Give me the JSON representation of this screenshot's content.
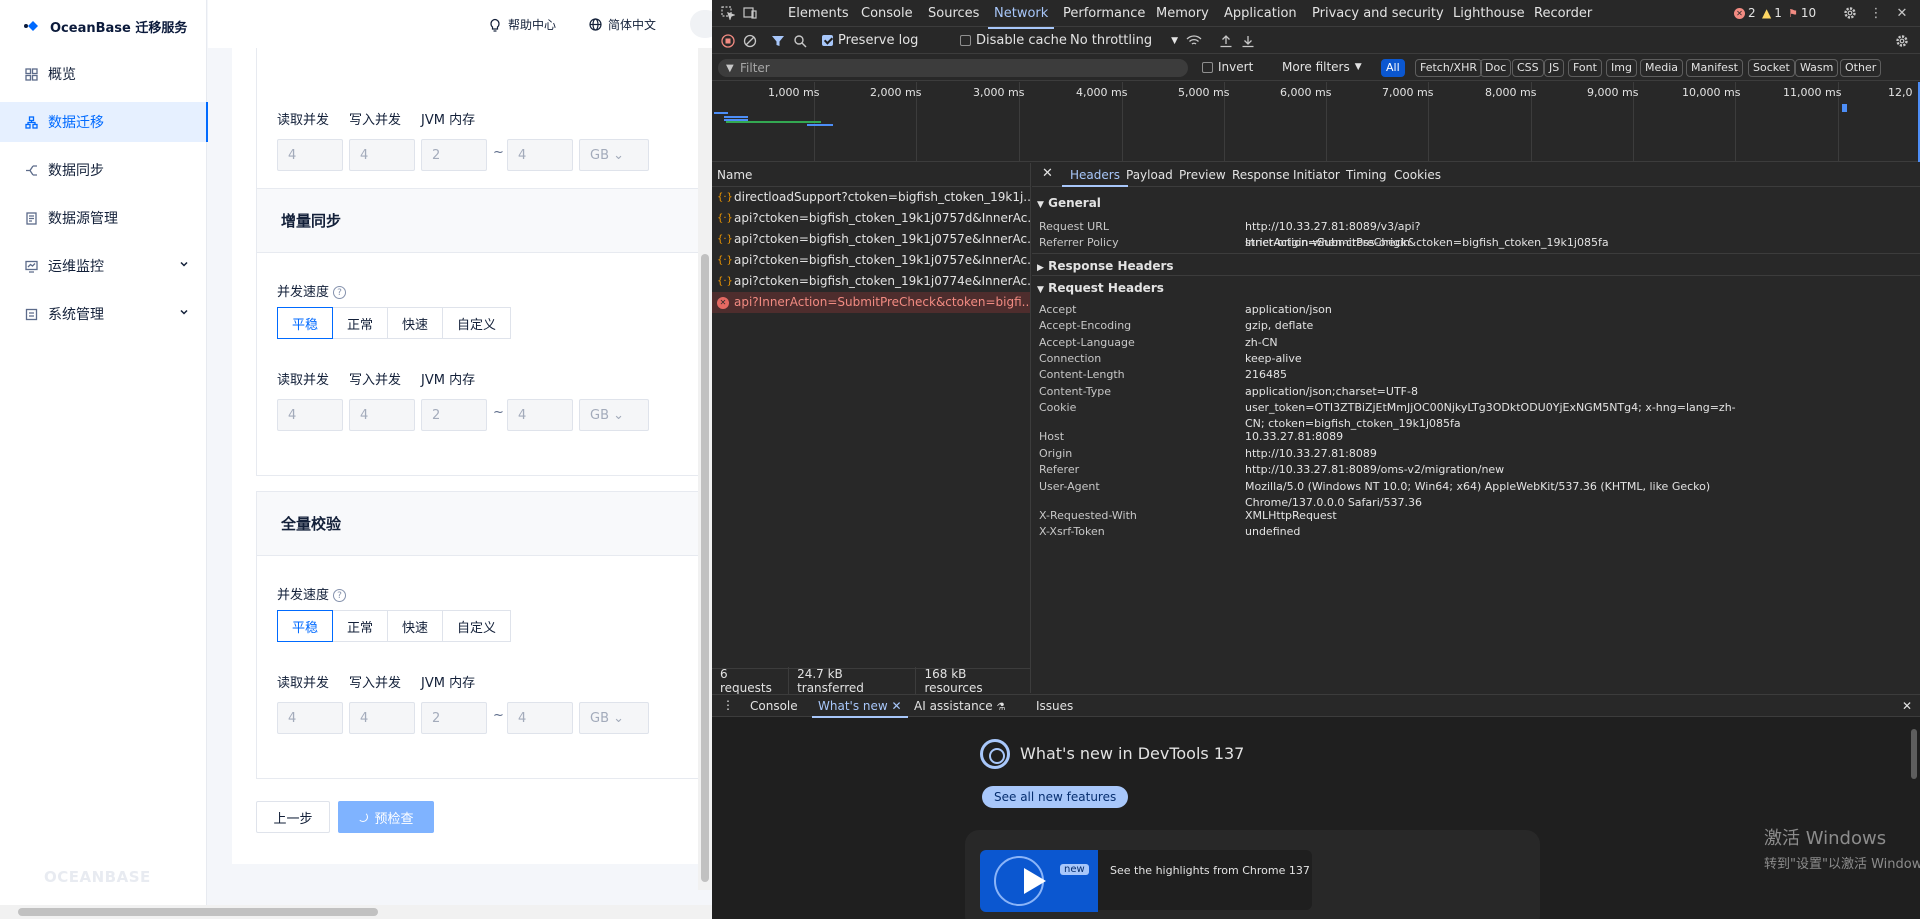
{
  "app": {
    "brand": "OceanBase 迁移服务",
    "footer_logo": "OCEANBASE",
    "sidebar": {
      "items": [
        {
          "label": "概览",
          "icon": "grid-icon"
        },
        {
          "label": "数据迁移",
          "icon": "migration-icon"
        },
        {
          "label": "数据同步",
          "icon": "sync-icon"
        },
        {
          "label": "数据源管理",
          "icon": "datasource-icon"
        },
        {
          "label": "运维监控",
          "icon": "monitor-icon"
        },
        {
          "label": "系统管理",
          "icon": "system-icon"
        }
      ]
    },
    "topbar": {
      "help": "帮助中心",
      "language": "简体中文"
    },
    "sections": {
      "fields": {
        "read": "读取并发",
        "write": "写入并发",
        "jvm": "JVM 内存",
        "tilde": "~",
        "unit": "GB"
      },
      "s0": {
        "read": "4",
        "write": "4",
        "jvm_min": "2",
        "jvm_max": "4"
      },
      "incremental": {
        "title": "增量同步",
        "speed_label": "并发速度",
        "read": "4",
        "write": "4",
        "jvm_min": "2",
        "jvm_max": "4"
      },
      "full": {
        "title": "全量校验",
        "speed_label": "并发速度",
        "read": "4",
        "write": "4",
        "jvm_min": "2",
        "jvm_max": "4"
      },
      "speed_options": [
        "平稳",
        "正常",
        "快速",
        "自定义"
      ],
      "help_glyph": "?"
    },
    "buttons": {
      "prev": "上一步",
      "precheck": "预检查"
    }
  },
  "devtools": {
    "tabs": [
      "Elements",
      "Console",
      "Sources",
      "Network",
      "Performance",
      "Memory",
      "Application",
      "Privacy and security",
      "Lighthouse",
      "Recorder"
    ],
    "badges": {
      "errors": "2",
      "warnings": "1",
      "issues": "10"
    },
    "toolbar": {
      "preserve_log": "Preserve log",
      "disable_cache": "Disable cache",
      "throttling": "No throttling"
    },
    "filter": {
      "placeholder": "Filter",
      "invert": "Invert",
      "more_filters": "More filters",
      "types": [
        "All",
        "Fetch/XHR",
        "Doc",
        "CSS",
        "JS",
        "Font",
        "Img",
        "Media",
        "Manifest",
        "Socket",
        "Wasm",
        "Other"
      ]
    },
    "timeline": {
      "ticks": [
        "1,000 ms",
        "2,000 ms",
        "3,000 ms",
        "4,000 ms",
        "5,000 ms",
        "6,000 ms",
        "7,000 ms",
        "8,000 ms",
        "9,000 ms",
        "10,000 ms",
        "11,000 ms",
        "12,0"
      ]
    },
    "requests": {
      "header": "Name",
      "rows": [
        {
          "name": "directloadSupport?ctoken=bigfish_ctoken_19k1j...",
          "error": false
        },
        {
          "name": "api?ctoken=bigfish_ctoken_19k1j0757d&InnerAc...",
          "error": false
        },
        {
          "name": "api?ctoken=bigfish_ctoken_19k1j0757e&InnerAc...",
          "error": false
        },
        {
          "name": "api?ctoken=bigfish_ctoken_19k1j0757e&InnerAc...",
          "error": false
        },
        {
          "name": "api?ctoken=bigfish_ctoken_19k1j0774e&InnerAc...",
          "error": false
        },
        {
          "name": "api?InnerAction=SubmitPreCheck&ctoken=bigfi...",
          "error": true
        }
      ],
      "status": {
        "requests": "6 requests",
        "transferred": "24.7 kB transferred",
        "resources": "168 kB resources"
      }
    },
    "detail_tabs": [
      "Headers",
      "Payload",
      "Preview",
      "Response",
      "Initiator",
      "Timing",
      "Cookies"
    ],
    "general": {
      "title": "General",
      "rows": [
        {
          "k": "Request URL",
          "v": "http://10.33.27.81:8089/v3/api?InnerAction=SubmitPreCheck&ctoken=bigfish_ctoken_19k1j085fa"
        },
        {
          "k": "Referrer Policy",
          "v": "strict-origin-when-cross-origin"
        }
      ]
    },
    "response_headers": {
      "title": "Response Headers"
    },
    "request_headers": {
      "title": "Request Headers",
      "rows": [
        {
          "k": "Accept",
          "v": "application/json"
        },
        {
          "k": "Accept-Encoding",
          "v": "gzip, deflate"
        },
        {
          "k": "Accept-Language",
          "v": "zh-CN"
        },
        {
          "k": "Connection",
          "v": "keep-alive"
        },
        {
          "k": "Content-Length",
          "v": "216485"
        },
        {
          "k": "Content-Type",
          "v": "application/json;charset=UTF-8"
        },
        {
          "k": "Cookie",
          "v": "user_token=OTI3ZTBiZjEtMmJjOC00NjkyLTg3ODktODU0YjExNGM5NTg4; x-hng=lang=zh-CN; ctoken=bigfish_ctoken_19k1j085fa"
        },
        {
          "k": "Host",
          "v": "10.33.27.81:8089"
        },
        {
          "k": "Origin",
          "v": "http://10.33.27.81:8089"
        },
        {
          "k": "Referer",
          "v": "http://10.33.27.81:8089/oms-v2/migration/new"
        },
        {
          "k": "User-Agent",
          "v": "Mozilla/5.0 (Windows NT 10.0; Win64; x64) AppleWebKit/537.36 (KHTML, like Gecko) Chrome/137.0.0.0 Safari/537.36"
        },
        {
          "k": "X-Requested-With",
          "v": "XMLHttpRequest"
        },
        {
          "k": "X-Xsrf-Token",
          "v": "undefined"
        }
      ]
    },
    "drawer": {
      "tabs": [
        "Console",
        "What's new",
        "AI assistance",
        "Issues"
      ],
      "whats_new_title": "What's new in DevTools 137",
      "see_all": "See all new features",
      "new_badge": "new",
      "highlight": "See the highlights from Chrome 137"
    }
  },
  "os": {
    "watermark_title": "激活 Windows",
    "watermark_sub": "转到\"设置\"以激活 Windows。"
  }
}
